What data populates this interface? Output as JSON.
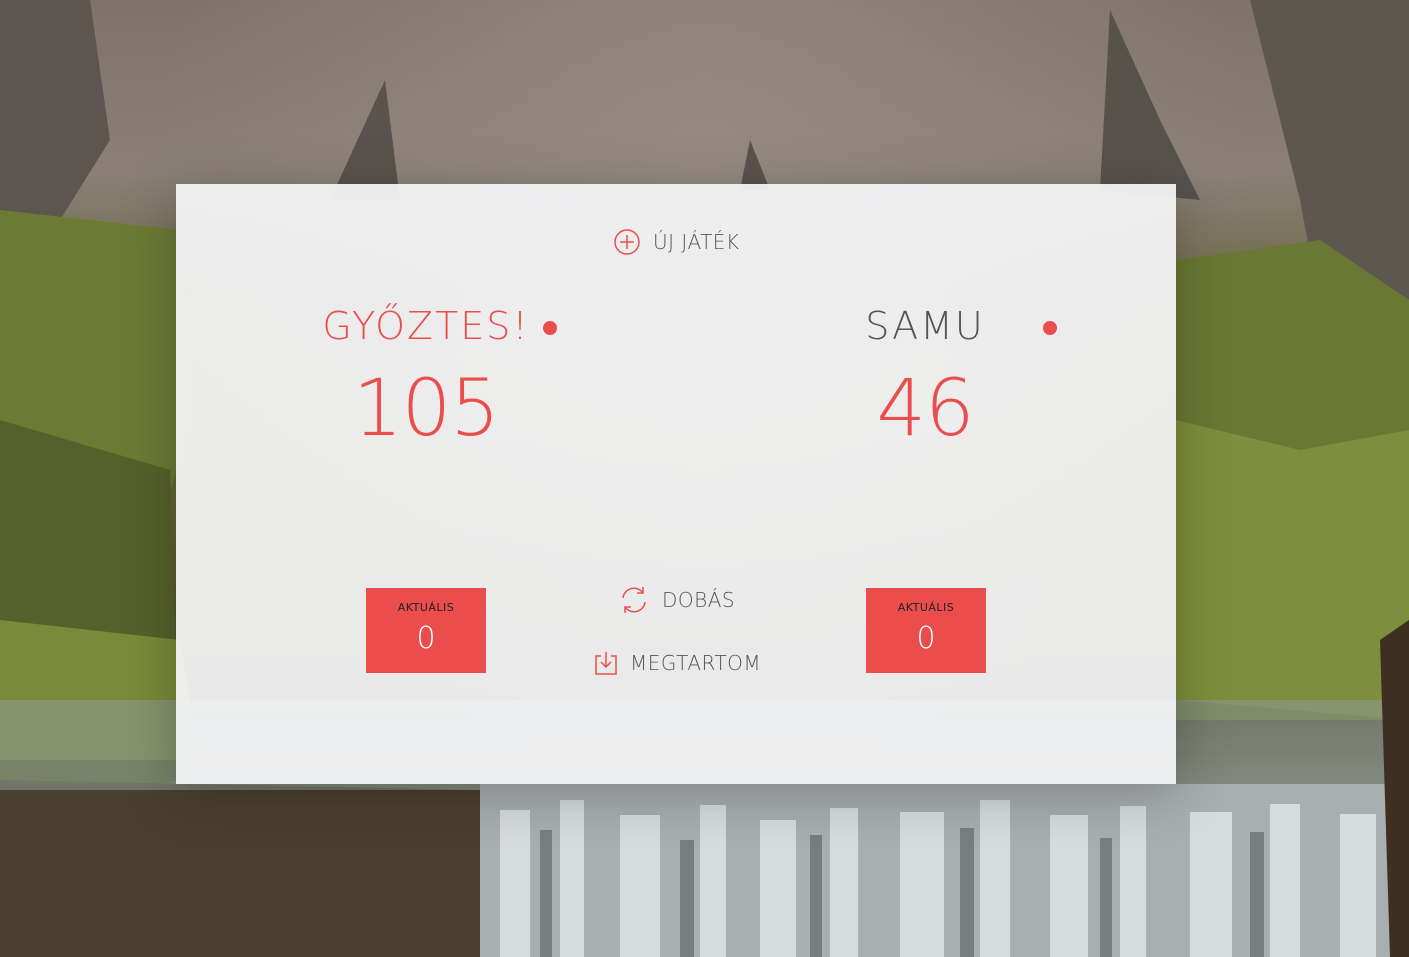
{
  "game": {
    "new_game_label": "ÚJ JÁTÉK",
    "roll_label": "DOBÁS",
    "hold_label": "MEGTARTOM"
  },
  "players": [
    {
      "name": "GYŐZTES!",
      "score": "105",
      "current_label": "AKTUÁLIS",
      "current_value": "0",
      "status": "winner"
    },
    {
      "name": "SAMU",
      "score": "46",
      "current_label": "AKTUÁLIS",
      "current_value": "0",
      "status": "normal"
    }
  ],
  "icons": {
    "new_game": "plus-circle-icon",
    "roll": "refresh-icon",
    "hold": "download-icon",
    "active_player": "dot-icon"
  },
  "colors": {
    "accent": "#eb4d4d",
    "text": "#555555",
    "panel": "#f5f5f7"
  }
}
